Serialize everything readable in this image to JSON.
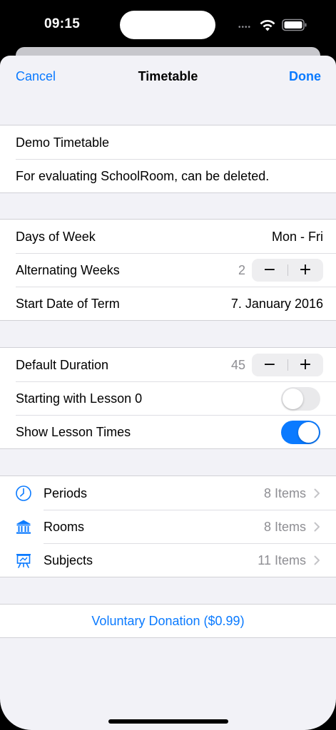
{
  "status_bar": {
    "time": "09:15"
  },
  "nav": {
    "cancel_label": "Cancel",
    "title": "Timetable",
    "done_label": "Done"
  },
  "info": {
    "name": "Demo Timetable",
    "description": "For evaluating SchoolRoom, can be deleted."
  },
  "schedule": {
    "days_label": "Days of Week",
    "days_value": "Mon - Fri",
    "alternating_label": "Alternating Weeks",
    "alternating_value": "2",
    "start_label": "Start Date of Term",
    "start_value": "7. January 2016"
  },
  "lessons": {
    "duration_label": "Default Duration",
    "duration_value": "45",
    "lesson0_label": "Starting with Lesson 0",
    "lesson0_on": false,
    "times_label": "Show Lesson Times",
    "times_on": true
  },
  "stepper": {
    "minus": "−",
    "plus": "+"
  },
  "lists": [
    {
      "label": "Periods",
      "count": "8 Items",
      "icon": "clock-icon"
    },
    {
      "label": "Rooms",
      "count": "8 Items",
      "icon": "building-columns-icon"
    },
    {
      "label": "Subjects",
      "count": "11 Items",
      "icon": "easel-icon"
    }
  ],
  "donation": {
    "label": "Voluntary Donation ($0.99)"
  },
  "colors": {
    "accent": "#0a7aff",
    "background": "#f2f2f7",
    "secondary_text": "#8e8e93"
  }
}
